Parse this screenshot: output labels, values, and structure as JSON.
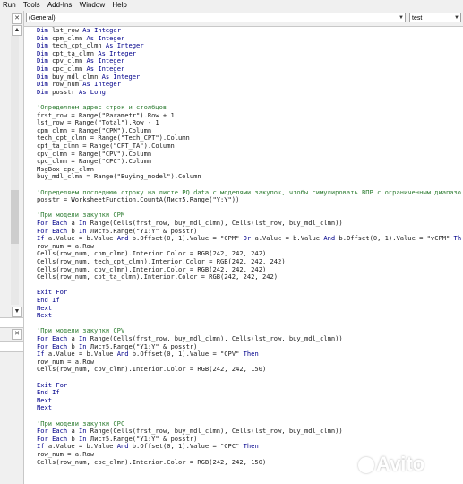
{
  "menu": [
    "Run",
    "Tools",
    "Add-Ins",
    "Window",
    "Help"
  ],
  "object_combo": "(General)",
  "proc_combo": "test",
  "code_lines": [
    [
      [
        "kw",
        "Dim "
      ],
      [
        "t",
        "lst_row "
      ],
      [
        "kw",
        "As Integer"
      ]
    ],
    [
      [
        "kw",
        "Dim "
      ],
      [
        "t",
        "cpm_clmn "
      ],
      [
        "kw",
        "As Integer"
      ]
    ],
    [
      [
        "kw",
        "Dim "
      ],
      [
        "t",
        "tech_cpt_clmn "
      ],
      [
        "kw",
        "As Integer"
      ]
    ],
    [
      [
        "kw",
        "Dim "
      ],
      [
        "t",
        "cpt_ta_clmn "
      ],
      [
        "kw",
        "As Integer"
      ]
    ],
    [
      [
        "kw",
        "Dim "
      ],
      [
        "t",
        "cpv_clmn "
      ],
      [
        "kw",
        "As Integer"
      ]
    ],
    [
      [
        "kw",
        "Dim "
      ],
      [
        "t",
        "cpc_clmn "
      ],
      [
        "kw",
        "As Integer"
      ]
    ],
    [
      [
        "kw",
        "Dim "
      ],
      [
        "t",
        "buy_mdl_clmn "
      ],
      [
        "kw",
        "As Integer"
      ]
    ],
    [
      [
        "kw",
        "Dim "
      ],
      [
        "t",
        "row_num "
      ],
      [
        "kw",
        "As Integer"
      ]
    ],
    [
      [
        "kw",
        "Dim "
      ],
      [
        "t",
        "posstr "
      ],
      [
        "kw",
        "As Long"
      ]
    ],
    [],
    [
      [
        "cm",
        "'Определяем адрес строк и столбцов"
      ]
    ],
    [
      [
        "t",
        "frst_row = Range(\"Parametr\").Row + 1"
      ]
    ],
    [
      [
        "t",
        "lst_row = Range(\"Total\").Row - 1"
      ]
    ],
    [
      [
        "t",
        "cpm_clmn = Range(\"CPM\").Column"
      ]
    ],
    [
      [
        "t",
        "tech_cpt_clmn = Range(\"Tech_CPT\").Column"
      ]
    ],
    [
      [
        "t",
        "cpt_ta_clmn = Range(\"CPT_TA\").Column"
      ]
    ],
    [
      [
        "t",
        "cpv_clmn = Range(\"CPV\").Column"
      ]
    ],
    [
      [
        "t",
        "cpc_clmn = Range(\"CPC\").Column"
      ]
    ],
    [
      [
        "t",
        "MsgBox cpc_clmn"
      ]
    ],
    [
      [
        "t",
        "buy_mdl_clmn = Range(\"Buying_model\").Column"
      ]
    ],
    [],
    [
      [
        "cm",
        "'Определяем последнюю строку на листе PQ data с моделями закупок, чтобы симулировать ВПР с ограниченным диапазо"
      ]
    ],
    [
      [
        "t",
        "posstr = WorksheetFunction.CountA(Лист5.Range(\"Y:Y\"))"
      ]
    ],
    [],
    [
      [
        "cm",
        "'При модели закупки CPM"
      ]
    ],
    [
      [
        "kw",
        "For Each "
      ],
      [
        "t",
        "a "
      ],
      [
        "kw",
        "In "
      ],
      [
        "t",
        "Range(Cells(frst_row, buy_mdl_clmn), Cells(lst_row, buy_mdl_clmn))"
      ]
    ],
    [
      [
        "kw",
        "For Each "
      ],
      [
        "t",
        "b "
      ],
      [
        "kw",
        "In "
      ],
      [
        "t",
        "Лист5.Range(\"Y1:Y\" & posstr)"
      ]
    ],
    [
      [
        "kw",
        "If "
      ],
      [
        "t",
        "a.Value = b.Value "
      ],
      [
        "kw",
        "And "
      ],
      [
        "t",
        "b.Offset(0, 1).Value = \"CPM\" "
      ],
      [
        "kw",
        "Or "
      ],
      [
        "t",
        "a.Value = b.Value "
      ],
      [
        "kw",
        "And "
      ],
      [
        "t",
        "b.Offset(0, 1).Value = \"vCPM\" "
      ],
      [
        "kw",
        "Th"
      ]
    ],
    [
      [
        "t",
        "row_num = a.Row"
      ]
    ],
    [
      [
        "t",
        "Cells(row_num, cpm_clmn).Interior.Color = RGB(242, 242, 242)"
      ]
    ],
    [
      [
        "t",
        "Cells(row_num, tech_cpt_clmn).Interior.Color = RGB(242, 242, 242)"
      ]
    ],
    [
      [
        "t",
        "Cells(row_num, cpv_clmn).Interior.Color = RGB(242, 242, 242)"
      ]
    ],
    [
      [
        "t",
        "Cells(row_num, cpt_ta_clmn).Interior.Color = RGB(242, 242, 242)"
      ]
    ],
    [],
    [
      [
        "kw",
        "Exit For"
      ]
    ],
    [
      [
        "kw",
        "End If"
      ]
    ],
    [
      [
        "kw",
        "Next"
      ]
    ],
    [
      [
        "kw",
        "Next"
      ]
    ],
    [],
    [
      [
        "cm",
        "'При модели закупки CPV"
      ]
    ],
    [
      [
        "kw",
        "For Each "
      ],
      [
        "t",
        "a "
      ],
      [
        "kw",
        "In "
      ],
      [
        "t",
        "Range(Cells(frst_row, buy_mdl_clmn), Cells(lst_row, buy_mdl_clmn))"
      ]
    ],
    [
      [
        "kw",
        "For Each "
      ],
      [
        "t",
        "b "
      ],
      [
        "kw",
        "In "
      ],
      [
        "t",
        "Лист5.Range(\"Y1:Y\" & posstr)"
      ]
    ],
    [
      [
        "kw",
        "If "
      ],
      [
        "t",
        "a.Value = b.Value "
      ],
      [
        "kw",
        "And "
      ],
      [
        "t",
        "b.Offset(0, 1).Value = \"CPV\" "
      ],
      [
        "kw",
        "Then"
      ]
    ],
    [
      [
        "t",
        "row_num = a.Row"
      ]
    ],
    [
      [
        "t",
        "Cells(row_num, cpv_clmn).Interior.Color = RGB(242, 242, 150)"
      ]
    ],
    [],
    [
      [
        "kw",
        "Exit For"
      ]
    ],
    [
      [
        "kw",
        "End If"
      ]
    ],
    [
      [
        "kw",
        "Next"
      ]
    ],
    [
      [
        "kw",
        "Next"
      ]
    ],
    [],
    [
      [
        "cm",
        "'При модели закупки CPC"
      ]
    ],
    [
      [
        "kw",
        "For Each "
      ],
      [
        "t",
        "a "
      ],
      [
        "kw",
        "In "
      ],
      [
        "t",
        "Range(Cells(frst_row, buy_mdl_clmn), Cells(lst_row, buy_mdl_clmn))"
      ]
    ],
    [
      [
        "kw",
        "For Each "
      ],
      [
        "t",
        "b "
      ],
      [
        "kw",
        "In "
      ],
      [
        "t",
        "Лист5.Range(\"Y1:Y\" & posstr)"
      ]
    ],
    [
      [
        "kw",
        "If "
      ],
      [
        "t",
        "a.Value = b.Value "
      ],
      [
        "kw",
        "And "
      ],
      [
        "t",
        "b.Offset(0, 1).Value = \"CPC\" "
      ],
      [
        "kw",
        "Then"
      ]
    ],
    [
      [
        "t",
        "row_num = a.Row"
      ]
    ],
    [
      [
        "t",
        "Cells(row_num, cpc_clmn).Interior.Color = RGB(242, 242, 150)"
      ]
    ]
  ],
  "watermark": "Avito",
  "colors": {
    "keyword": "#00008b",
    "comment": "#2e7d32",
    "text": "#1a1a1a"
  }
}
